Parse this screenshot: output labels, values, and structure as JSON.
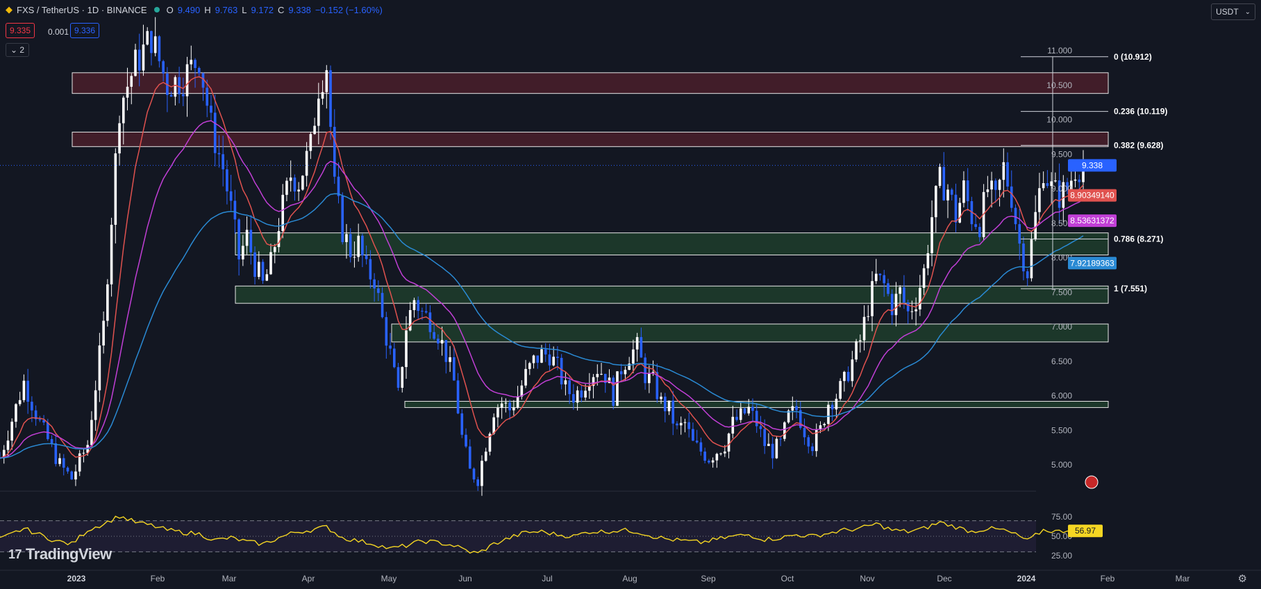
{
  "header": {
    "symbol": "FXS / TetherUS · 1D · BINANCE",
    "open_label": "O",
    "open": "9.490",
    "high_label": "H",
    "high": "9.763",
    "low_label": "L",
    "low": "9.172",
    "close_label": "C",
    "close": "9.338",
    "change": "−0.152 (−1.60%)"
  },
  "quotes": {
    "bid": "9.335",
    "spread": "0.001",
    "ask": "9.336"
  },
  "indicator_toggle": "2",
  "currency_selector": {
    "value": "USDT"
  },
  "watermark": "TradingView",
  "colors": {
    "background": "#131722",
    "up": "#ffffff",
    "down": "#2962ff",
    "ema_red": "#e0524f",
    "ema_magenta": "#c13fd6",
    "ema_blue": "#2a8ad4",
    "zone_resistance": "#4a1e2a",
    "zone_support": "#1e3d2c",
    "rsi": "#f5d623"
  },
  "chart_data": {
    "type": "candlestick",
    "price_axis": {
      "ticks": [
        "11.000",
        "10.500",
        "10.000",
        "9.500",
        "9.000",
        "8.500",
        "8.000",
        "7.500",
        "7.000",
        "6.500",
        "6.000",
        "5.500",
        "5.000"
      ]
    },
    "time_axis": [
      "2023",
      "Feb",
      "Mar",
      "Apr",
      "May",
      "Jun",
      "Jul",
      "Aug",
      "Sep",
      "Oct",
      "Nov",
      "Dec",
      "2024",
      "Feb",
      "Mar"
    ],
    "last_price": "9.338",
    "ema_labels": [
      {
        "text": "8.90349140",
        "color": "#e0524f",
        "value": 8.9035
      },
      {
        "text": "8.53631372",
        "color": "#c13fd6",
        "value": 8.5363
      },
      {
        "text": "7.92189363",
        "color": "#2a8ad4",
        "value": 7.9219
      }
    ],
    "fibonacci": [
      {
        "label": "0 (10.912)",
        "value": 10.912
      },
      {
        "label": "0.236 (10.119)",
        "value": 10.119
      },
      {
        "label": "0.382 (9.628)",
        "value": 9.628
      },
      {
        "label": "0.786 (8.271)",
        "value": 8.271
      },
      {
        "label": "1 (7.551)",
        "value": 7.551
      }
    ],
    "zones": [
      {
        "kind": "resistance",
        "top": 10.68,
        "bottom": 10.38
      },
      {
        "kind": "resistance",
        "top": 9.82,
        "bottom": 9.61
      },
      {
        "kind": "support",
        "top": 8.36,
        "bottom": 8.04
      },
      {
        "kind": "support",
        "top": 7.59,
        "bottom": 7.34
      },
      {
        "kind": "support",
        "top": 7.04,
        "bottom": 6.78
      },
      {
        "kind": "support",
        "top": 5.92,
        "bottom": 5.83
      }
    ],
    "price_path": [
      [
        0,
        5.1
      ],
      [
        6,
        6.2
      ],
      [
        10,
        5.6
      ],
      [
        15,
        5.0
      ],
      [
        18,
        4.8
      ],
      [
        22,
        5.3
      ],
      [
        26,
        7.0
      ],
      [
        30,
        10.2
      ],
      [
        34,
        10.8
      ],
      [
        38,
        11.2
      ],
      [
        42,
        10.5
      ],
      [
        46,
        10.6
      ],
      [
        50,
        10.9
      ],
      [
        53,
        9.9
      ],
      [
        56,
        9.3
      ],
      [
        58,
        8.7
      ],
      [
        60,
        8.0
      ],
      [
        62,
        8.3
      ],
      [
        64,
        7.9
      ],
      [
        66,
        7.6
      ],
      [
        68,
        7.9
      ],
      [
        70,
        8.5
      ],
      [
        73,
        9.2
      ],
      [
        75,
        9.1
      ],
      [
        78,
        9.6
      ],
      [
        80,
        10.5
      ],
      [
        82,
        10.8
      ],
      [
        84,
        9.0
      ],
      [
        86,
        8.4
      ],
      [
        88,
        8.1
      ],
      [
        90,
        8.2
      ],
      [
        92,
        7.8
      ],
      [
        94,
        7.7
      ],
      [
        96,
        7.1
      ],
      [
        98,
        6.6
      ],
      [
        100,
        6.0
      ],
      [
        102,
        7.0
      ],
      [
        104,
        7.4
      ],
      [
        106,
        7.2
      ],
      [
        108,
        7.1
      ],
      [
        110,
        6.9
      ],
      [
        112,
        6.6
      ],
      [
        114,
        6.2
      ],
      [
        116,
        5.4
      ],
      [
        118,
        4.9
      ],
      [
        120,
        4.8
      ],
      [
        122,
        5.3
      ],
      [
        124,
        5.8
      ],
      [
        126,
        5.9
      ],
      [
        128,
        5.8
      ],
      [
        130,
        6.0
      ],
      [
        132,
        6.3
      ],
      [
        134,
        6.5
      ],
      [
        136,
        6.6
      ],
      [
        138,
        6.6
      ],
      [
        140,
        6.4
      ],
      [
        142,
        6.1
      ],
      [
        144,
        6.0
      ],
      [
        146,
        6.1
      ],
      [
        148,
        6.3
      ],
      [
        150,
        6.4
      ],
      [
        152,
        6.3
      ],
      [
        154,
        6.0
      ],
      [
        156,
        6.4
      ],
      [
        158,
        6.6
      ],
      [
        160,
        6.7
      ],
      [
        162,
        6.3
      ],
      [
        164,
        6.2
      ],
      [
        166,
        5.9
      ],
      [
        168,
        5.8
      ],
      [
        170,
        5.5
      ],
      [
        172,
        5.6
      ],
      [
        174,
        5.3
      ],
      [
        176,
        5.2
      ],
      [
        178,
        5.1
      ],
      [
        180,
        5.2
      ],
      [
        182,
        5.3
      ],
      [
        184,
        5.6
      ],
      [
        186,
        5.7
      ],
      [
        188,
        5.8
      ],
      [
        190,
        5.6
      ],
      [
        192,
        5.3
      ],
      [
        194,
        5.2
      ],
      [
        196,
        5.3
      ],
      [
        198,
        5.7
      ],
      [
        200,
        5.8
      ],
      [
        202,
        5.5
      ],
      [
        204,
        5.3
      ],
      [
        206,
        5.5
      ],
      [
        208,
        5.9
      ],
      [
        210,
        6.0
      ],
      [
        212,
        6.2
      ],
      [
        214,
        6.5
      ],
      [
        216,
        6.8
      ],
      [
        218,
        7.3
      ],
      [
        220,
        7.7
      ],
      [
        222,
        7.6
      ],
      [
        224,
        7.3
      ],
      [
        226,
        7.5
      ],
      [
        228,
        7.2
      ],
      [
        230,
        7.4
      ],
      [
        232,
        7.8
      ],
      [
        234,
        8.6
      ],
      [
        236,
        9.1
      ],
      [
        238,
        9.0
      ],
      [
        240,
        8.6
      ],
      [
        242,
        9.0
      ],
      [
        244,
        8.6
      ],
      [
        246,
        8.5
      ],
      [
        248,
        9.0
      ],
      [
        250,
        8.8
      ],
      [
        252,
        9.3
      ],
      [
        254,
        8.9
      ],
      [
        256,
        8.2
      ],
      [
        258,
        7.8
      ],
      [
        260,
        8.6
      ],
      [
        262,
        9.3
      ],
      [
        264,
        9.0
      ],
      [
        266,
        8.9
      ],
      [
        268,
        9.0
      ],
      [
        270,
        9.3
      ],
      [
        272,
        9.34
      ]
    ],
    "rsi": {
      "value": "56.97",
      "ticks": [
        "75.00",
        "50.00",
        "25.00"
      ],
      "overbought": 70,
      "oversold": 30,
      "mid": 50,
      "path": [
        [
          0,
          46
        ],
        [
          6,
          60
        ],
        [
          10,
          52
        ],
        [
          14,
          44
        ],
        [
          18,
          40
        ],
        [
          22,
          58
        ],
        [
          26,
          66
        ],
        [
          30,
          76
        ],
        [
          34,
          68
        ],
        [
          38,
          64
        ],
        [
          42,
          58
        ],
        [
          46,
          55
        ],
        [
          50,
          53
        ],
        [
          54,
          45
        ],
        [
          58,
          48
        ],
        [
          62,
          43
        ],
        [
          66,
          40
        ],
        [
          70,
          48
        ],
        [
          74,
          55
        ],
        [
          78,
          58
        ],
        [
          82,
          62
        ],
        [
          86,
          48
        ],
        [
          90,
          44
        ],
        [
          94,
          40
        ],
        [
          98,
          34
        ],
        [
          102,
          38
        ],
        [
          106,
          44
        ],
        [
          110,
          42
        ],
        [
          114,
          38
        ],
        [
          118,
          30
        ],
        [
          120,
          28
        ],
        [
          124,
          40
        ],
        [
          128,
          48
        ],
        [
          132,
          55
        ],
        [
          136,
          56
        ],
        [
          140,
          52
        ],
        [
          144,
          50
        ],
        [
          148,
          56
        ],
        [
          152,
          56
        ],
        [
          156,
          58
        ],
        [
          160,
          56
        ],
        [
          164,
          50
        ],
        [
          168,
          46
        ],
        [
          172,
          44
        ],
        [
          176,
          42
        ],
        [
          180,
          46
        ],
        [
          184,
          50
        ],
        [
          188,
          52
        ],
        [
          192,
          46
        ],
        [
          196,
          48
        ],
        [
          200,
          52
        ],
        [
          204,
          50
        ],
        [
          208,
          54
        ],
        [
          212,
          58
        ],
        [
          216,
          60
        ],
        [
          220,
          66
        ],
        [
          224,
          58
        ],
        [
          228,
          56
        ],
        [
          232,
          60
        ],
        [
          236,
          68
        ],
        [
          240,
          62
        ],
        [
          244,
          56
        ],
        [
          248,
          60
        ],
        [
          252,
          58
        ],
        [
          256,
          50
        ],
        [
          258,
          44
        ],
        [
          262,
          58
        ],
        [
          266,
          56
        ],
        [
          270,
          60
        ],
        [
          272,
          57
        ]
      ]
    }
  }
}
